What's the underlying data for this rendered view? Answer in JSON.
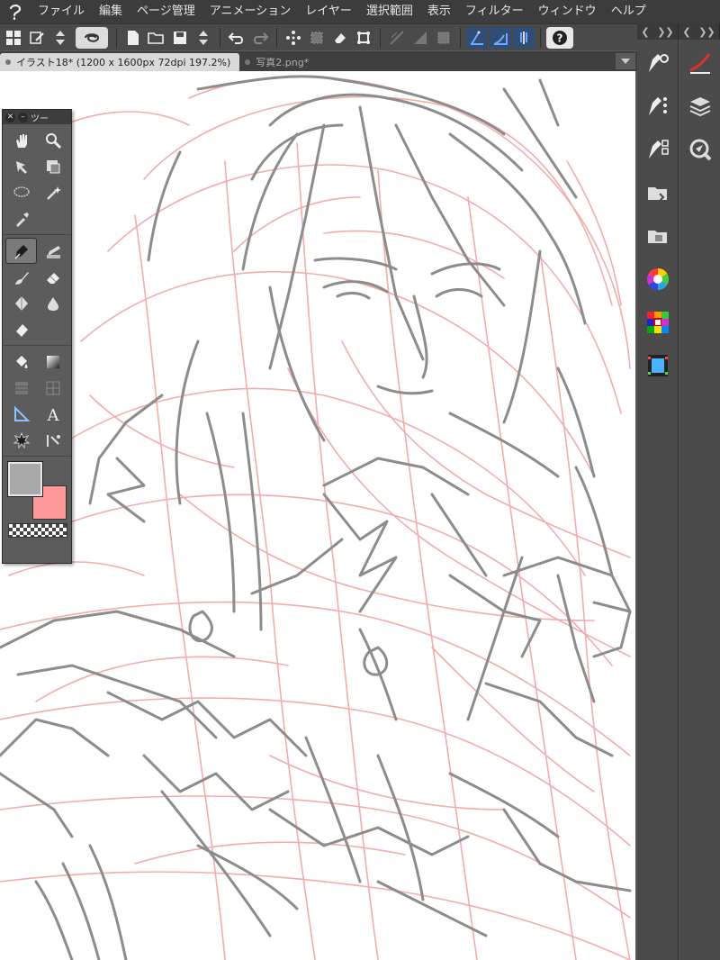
{
  "menubar": {
    "items": [
      "ファイル",
      "編集",
      "ページ管理",
      "アニメーション",
      "レイヤー",
      "選択範囲",
      "表示",
      "フィルター",
      "ウィンドウ",
      "ヘルプ"
    ]
  },
  "tabs": [
    {
      "label": "イラスト18* (1200 x 1600px 72dpi 197.2%)",
      "active": true
    },
    {
      "label": "写真2.png*",
      "active": false
    }
  ],
  "tool_palette": {
    "title": "ツー"
  },
  "colors": {
    "main": "#a8a8a8",
    "sub": "#ff9a9a",
    "sketch_gray": "#8c8c8c",
    "sketch_pink": "#f2a8a8",
    "accent": "#2f4d75"
  },
  "icons": {
    "toolbar": [
      "grid-icon",
      "edit-doc-icon",
      "updown-icon",
      "swirl-icon",
      "new-icon",
      "open-icon",
      "save-icon",
      "updown-icon",
      "undo-icon",
      "redo-icon",
      "transform-icon",
      "fill-selection-icon",
      "eraser-selection-icon",
      "crop-icon",
      "ruler-icon",
      "hatch-icon",
      "frame-icon",
      "snap-ruler-icon",
      "snap-special-icon",
      "snap-grid-icon",
      "help-icon"
    ],
    "tools": [
      "hand-icon",
      "zoom-icon",
      "move-icon",
      "layer-move-icon",
      "lasso-icon",
      "magic-wand-icon",
      "eyedropper-icon",
      "pen-icon",
      "pencil-icon",
      "brush-icon",
      "eraser-icon",
      "blend-icon",
      "water-icon",
      "cleaner-icon",
      "fill-icon",
      "gradient-icon",
      "frame-border-icon",
      "tone-icon",
      "ruler-tool-icon",
      "text-icon",
      "balloon-icon",
      "line-correct-icon"
    ],
    "dock_left": [
      "tool-property-icon",
      "sub-tool-icon",
      "sub-tool-detail-icon",
      "layer-property-icon",
      "material-icon",
      "color-wheel-icon",
      "color-set-icon",
      "timeline-icon"
    ],
    "dock_right": [
      "brush-size-icon",
      "layer-icon",
      "navigator-icon"
    ]
  }
}
